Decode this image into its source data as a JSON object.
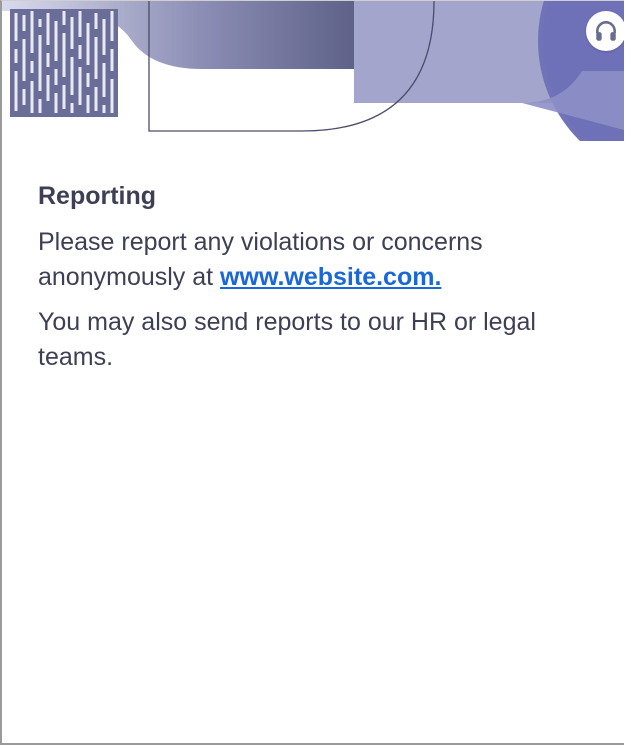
{
  "colors": {
    "text": "#3e3f55",
    "link": "#1a67d8",
    "accent_purple": "#6e70b8",
    "accent_light": "#a9aad0",
    "accent_dark": "#5c5f86"
  },
  "header": {
    "support_icon": "headphones-icon"
  },
  "content": {
    "heading": "Reporting",
    "para1_text": "Please report any violations or concerns anonymously at ",
    "para1_link": "www.website.com.",
    "para2_text": "You may also send reports to our HR or legal teams."
  }
}
